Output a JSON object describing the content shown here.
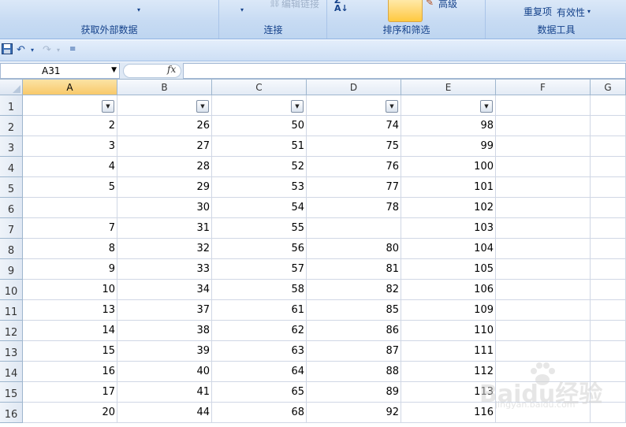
{
  "ribbon": {
    "groups": [
      {
        "label": "获取外部数据"
      },
      {
        "label": "连接"
      },
      {
        "label": "排序和筛选"
      },
      {
        "label": "数据工具"
      }
    ],
    "edit_links": "编辑链接",
    "advanced": "高级",
    "remove_duplicates": "重复项",
    "data_validity": "有效性"
  },
  "formula_bar": {
    "name_box": "A31",
    "fx": "fx",
    "value": ""
  },
  "columns": [
    "A",
    "B",
    "C",
    "D",
    "E",
    "F",
    "G"
  ],
  "rows": [
    {
      "n": "1",
      "cells": [
        "",
        "",
        "",
        "",
        "",
        "",
        ""
      ]
    },
    {
      "n": "2",
      "cells": [
        "2",
        "26",
        "50",
        "74",
        "98",
        "",
        ""
      ]
    },
    {
      "n": "3",
      "cells": [
        "3",
        "27",
        "51",
        "75",
        "99",
        "",
        ""
      ]
    },
    {
      "n": "4",
      "cells": [
        "4",
        "28",
        "52",
        "76",
        "100",
        "",
        ""
      ]
    },
    {
      "n": "5",
      "cells": [
        "5",
        "29",
        "53",
        "77",
        "101",
        "",
        ""
      ]
    },
    {
      "n": "6",
      "cells": [
        "",
        "30",
        "54",
        "78",
        "102",
        "",
        ""
      ]
    },
    {
      "n": "7",
      "cells": [
        "7",
        "31",
        "55",
        "",
        "103",
        "",
        ""
      ]
    },
    {
      "n": "8",
      "cells": [
        "8",
        "32",
        "56",
        "80",
        "104",
        "",
        ""
      ]
    },
    {
      "n": "9",
      "cells": [
        "9",
        "33",
        "57",
        "81",
        "105",
        "",
        ""
      ]
    },
    {
      "n": "10",
      "cells": [
        "10",
        "34",
        "58",
        "82",
        "106",
        "",
        ""
      ]
    },
    {
      "n": "11",
      "cells": [
        "13",
        "37",
        "61",
        "85",
        "109",
        "",
        ""
      ]
    },
    {
      "n": "12",
      "cells": [
        "14",
        "38",
        "62",
        "86",
        "110",
        "",
        ""
      ]
    },
    {
      "n": "13",
      "cells": [
        "15",
        "39",
        "63",
        "87",
        "111",
        "",
        ""
      ]
    },
    {
      "n": "14",
      "cells": [
        "16",
        "40",
        "64",
        "88",
        "112",
        "",
        ""
      ]
    },
    {
      "n": "15",
      "cells": [
        "17",
        "41",
        "65",
        "89",
        "113",
        "",
        ""
      ]
    },
    {
      "n": "16",
      "cells": [
        "20",
        "44",
        "68",
        "92",
        "116",
        "",
        ""
      ]
    }
  ],
  "watermark": {
    "logo": "Baidu经验",
    "url": "jingyan.baidu.com"
  }
}
